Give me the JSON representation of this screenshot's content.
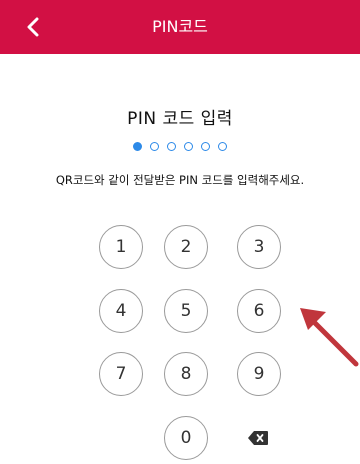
{
  "header": {
    "title": "PIN코드",
    "back_icon": "chevron-left-icon"
  },
  "prompt": {
    "title": "PIN 코드 입력",
    "hint": "QR코드와 같이 전달받은 PIN 코드를 입력해주세요."
  },
  "pin": {
    "length": 6,
    "filled": 1
  },
  "keypad": {
    "k1": "1",
    "k2": "2",
    "k3": "3",
    "k4": "4",
    "k5": "5",
    "k6": "6",
    "k7": "7",
    "k8": "8",
    "k9": "9",
    "k0": "0",
    "delete_icon": "backspace-icon"
  },
  "colors": {
    "header_bg": "#d21044",
    "accent": "#2d8ae8",
    "arrow": "#c0363c"
  }
}
